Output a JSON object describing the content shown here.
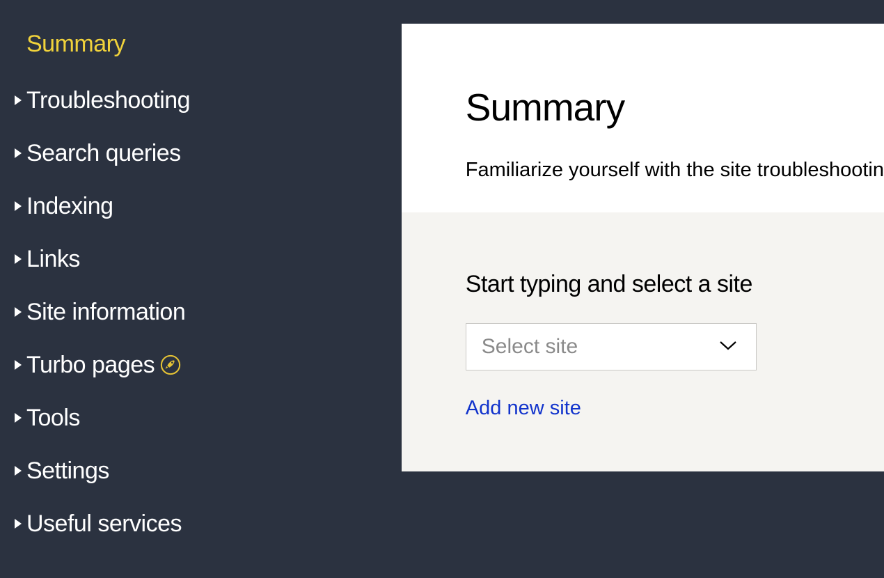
{
  "sidebar": {
    "items": [
      {
        "label": "Summary",
        "active": true,
        "expandable": false
      },
      {
        "label": "Troubleshooting",
        "expandable": true
      },
      {
        "label": "Search queries",
        "expandable": true
      },
      {
        "label": "Indexing",
        "expandable": true
      },
      {
        "label": "Links",
        "expandable": true
      },
      {
        "label": "Site information",
        "expandable": true
      },
      {
        "label": "Turbo pages",
        "expandable": true,
        "icon": "rocket"
      },
      {
        "label": "Tools",
        "expandable": true
      },
      {
        "label": "Settings",
        "expandable": true
      },
      {
        "label": "Useful services",
        "expandable": true
      }
    ]
  },
  "main": {
    "title": "Summary",
    "subtitle": "Familiarize yourself with the site troubleshootin",
    "select_section": {
      "label": "Start typing and select a site",
      "placeholder": "Select site",
      "add_link": "Add new site"
    }
  }
}
